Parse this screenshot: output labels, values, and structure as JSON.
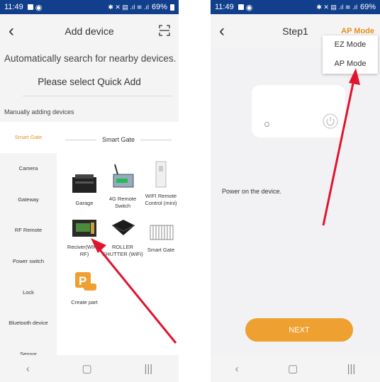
{
  "left": {
    "status": {
      "time": "11:49",
      "signal": "⚡ ⨯ ☰ .ıl ¹¹¹ .ıl",
      "battery": "69%"
    },
    "header": {
      "title": "Add device"
    },
    "auto_search": "Automatically search for nearby devices.",
    "quick_add": "Please select Quick Add",
    "manual_label": "Manually adding devices",
    "sidebar": [
      {
        "label": "Smart Gate"
      },
      {
        "label": "Camera"
      },
      {
        "label": "Gateway"
      },
      {
        "label": "RF Remote"
      },
      {
        "label": "Power switch"
      },
      {
        "label": "Lock"
      },
      {
        "label": "Bluetooth device"
      },
      {
        "label": "Sensor"
      }
    ],
    "category_title": "Smart Gate",
    "devices": [
      {
        "label": "Garage"
      },
      {
        "label": "4G Remote Switch"
      },
      {
        "label": "WIFI Remote Control (mini)"
      },
      {
        "label": "Reciver(WIFI+ RF)"
      },
      {
        "label": "ROLLER SHUTTER (WiFi)"
      },
      {
        "label": "Smart Gate"
      },
      {
        "label": "Create part"
      }
    ]
  },
  "right": {
    "status": {
      "time": "11:49",
      "battery": "69%"
    },
    "header": {
      "title": "Step1",
      "mode_link": "AP Mode"
    },
    "dropdown": [
      {
        "label": "EZ Mode"
      },
      {
        "label": "AP Mode"
      }
    ],
    "power_text": "Power on the device.",
    "next_label": "NEXT"
  },
  "nav": {
    "back": "‹",
    "home": "▢",
    "recent": "|||"
  },
  "colors": {
    "accent": "#e6901e",
    "status_bar": "#123f8b",
    "arrow": "#e0142c",
    "button": "#eea030"
  }
}
